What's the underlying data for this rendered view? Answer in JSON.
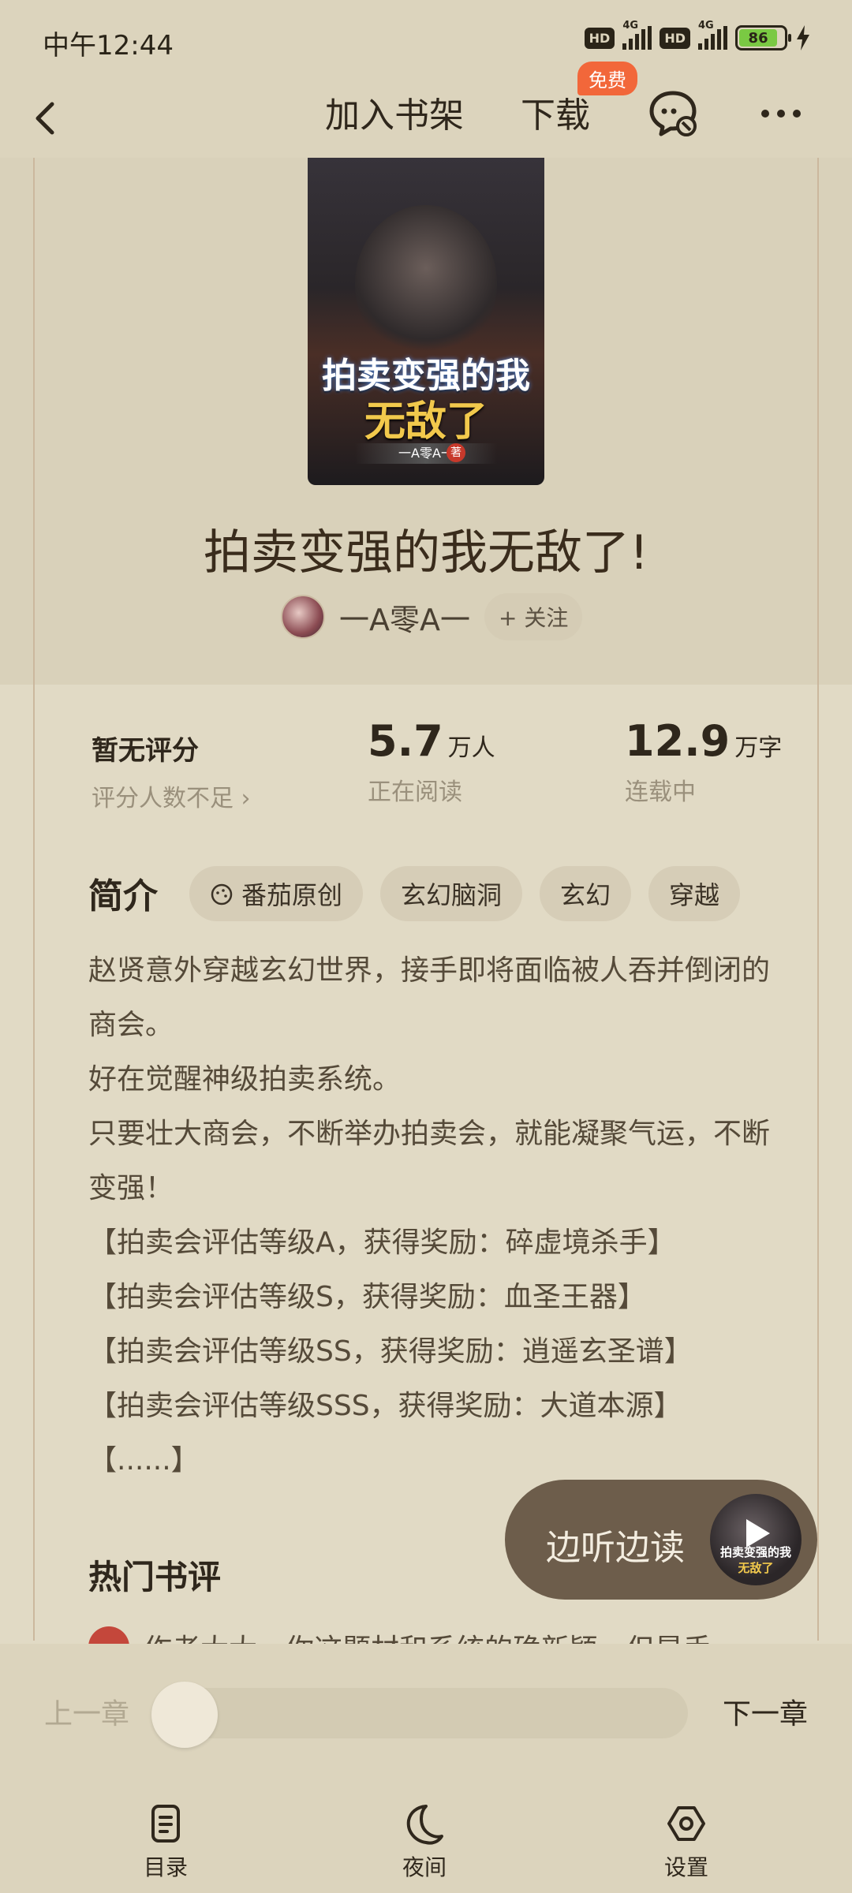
{
  "status": {
    "time": "中午12:44",
    "battery": "86",
    "network1": "4G",
    "network2": "4G",
    "hd": "HD"
  },
  "header": {
    "add_shelf": "加入书架",
    "download": "下载",
    "free_badge": "免费"
  },
  "book": {
    "cover_title_1": "拍卖变强的我",
    "cover_title_2": "无敌了",
    "cover_author": "一A零A一",
    "cover_mark": "著",
    "title": "拍卖变强的我无敌了!",
    "author": "一A零A一",
    "follow_label": "+ 关注"
  },
  "stats": {
    "rating": "暂无评分",
    "rating_sub": "评分人数不足 ›",
    "readers_num": "5.7",
    "readers_unit": "万人",
    "readers_sub": "正在阅读",
    "words_num": "12.9",
    "words_unit": "万字",
    "words_sub": "连载中"
  },
  "intro": {
    "heading": "简介",
    "tags": [
      "番茄原创",
      "玄幻脑洞",
      "玄幻",
      "穿越"
    ],
    "lines": [
      "赵贤意外穿越玄幻世界，接手即将面临被人吞并倒闭的商会。",
      "好在觉醒神级拍卖系统。",
      "只要壮大商会，不断举办拍卖会，就能凝聚气运，不断变强！",
      "【拍卖会评估等级A，获得奖励：碎虚境杀手】",
      "【拍卖会评估等级S，获得奖励：血圣王器】",
      "【拍卖会评估等级SS，获得奖励：逍遥玄圣谱】",
      "【拍卖会评估等级SSS，获得奖励：大道本源】",
      "【......】"
    ]
  },
  "reviews": {
    "heading": "热门书评",
    "first_partial": "作者大大，你这题材和系统的确新颖，但是手"
  },
  "listen": {
    "label": "边听边读",
    "thumb_title_1": "拍卖变强的我",
    "thumb_title_2": "无敌了"
  },
  "bottom": {
    "prev": "上一章",
    "next": "下一章",
    "progress": 0,
    "nav": [
      {
        "label": "目录",
        "icon": "catalog-icon"
      },
      {
        "label": "夜间",
        "icon": "moon-icon"
      },
      {
        "label": "设置",
        "icon": "settings-icon"
      }
    ]
  }
}
